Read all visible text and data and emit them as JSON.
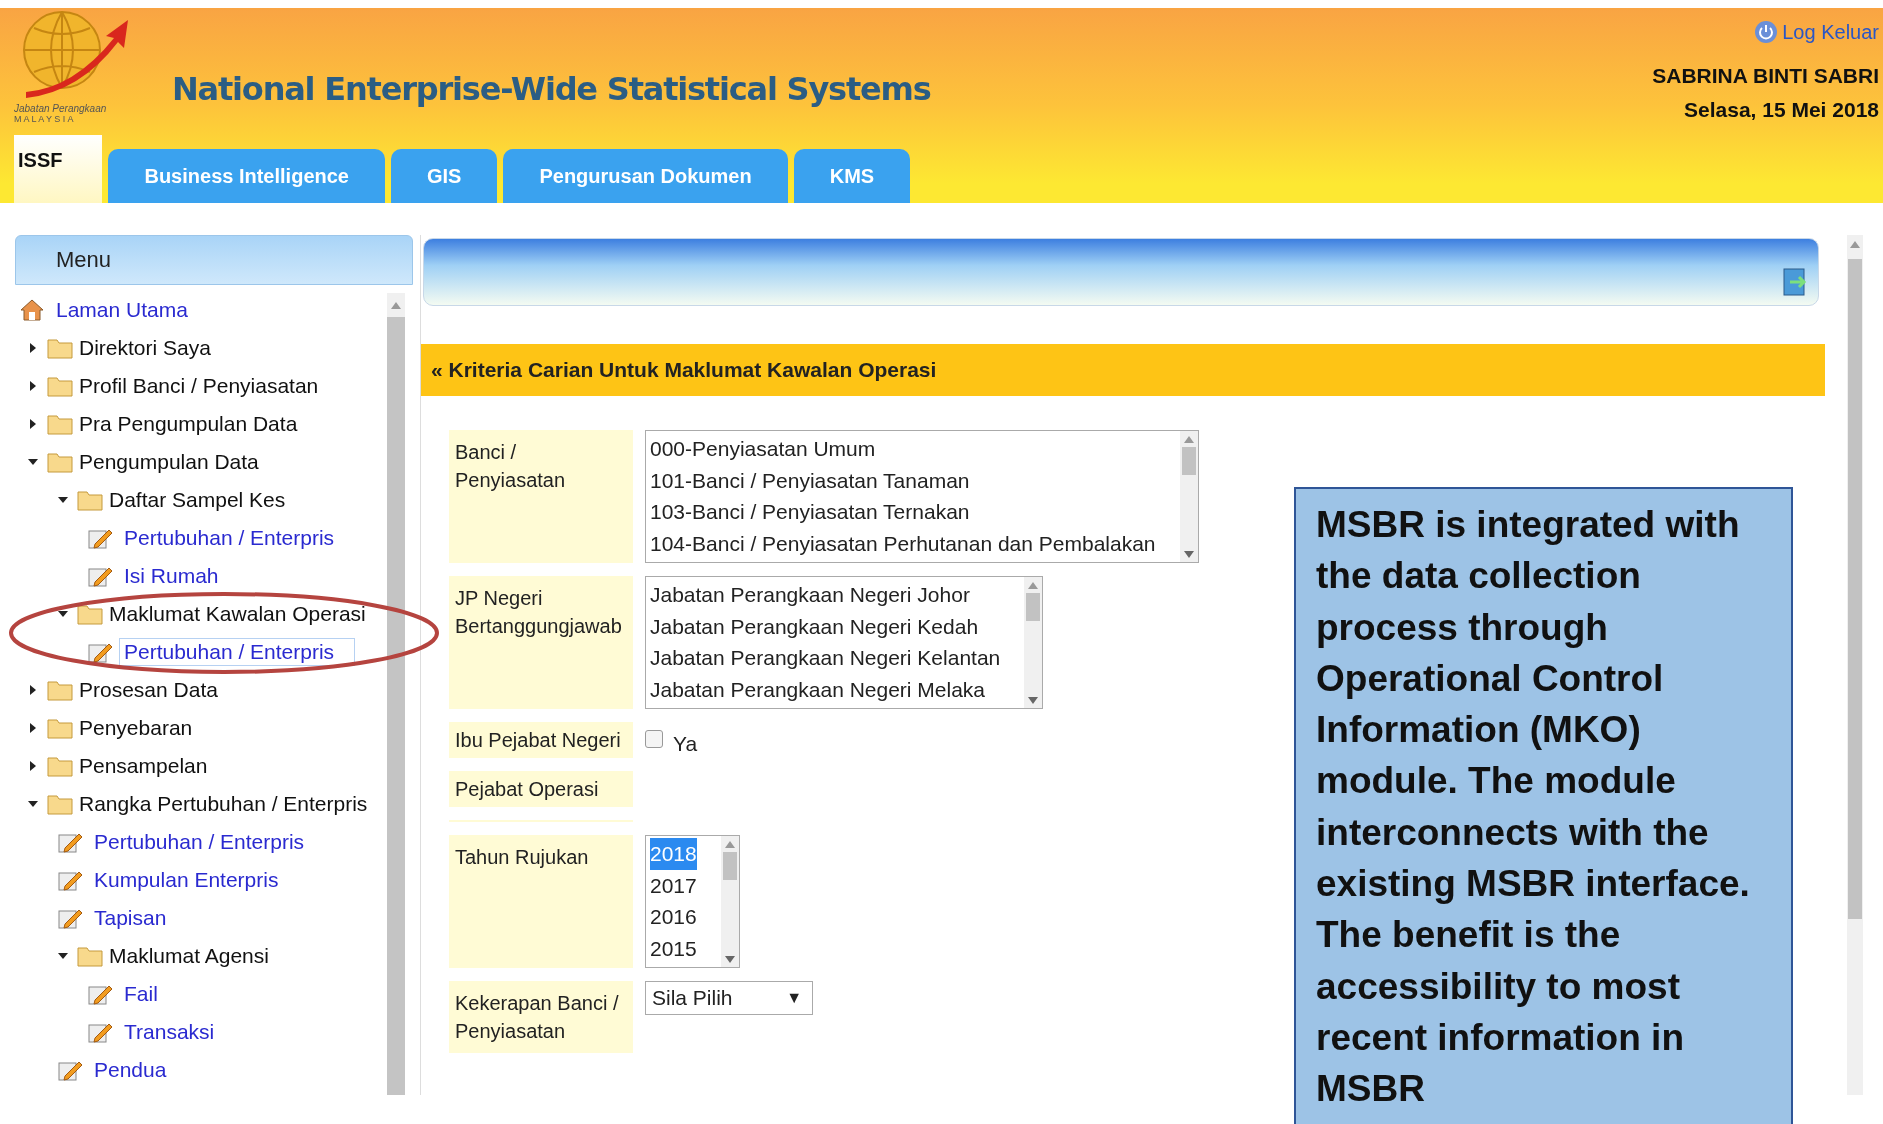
{
  "header": {
    "logo_text": "Jabatan Perangkaan",
    "logo_subtext": "M A L A Y S I A",
    "title": "National Enterprise-Wide Statistical Systems",
    "logout": "Log Keluar",
    "user": "SABRINA BINTI SABRI",
    "date": "Selasa, 15 Mei 2018"
  },
  "tabs": [
    {
      "label": "ISSF",
      "selected": true
    },
    {
      "label": "Business Intelligence",
      "selected": false
    },
    {
      "label": "GIS",
      "selected": false
    },
    {
      "label": "Pengurusan Dokumen",
      "selected": false
    },
    {
      "label": "KMS",
      "selected": false
    }
  ],
  "sidebar": {
    "title": "Menu",
    "items": [
      {
        "kind": "home",
        "label": "Laman Utama",
        "selected": false
      },
      {
        "kind": "folder",
        "label": "Direktori Saya",
        "expanded": false
      },
      {
        "kind": "folder",
        "label": "Profil Banci / Penyiasatan",
        "expanded": false
      },
      {
        "kind": "folder",
        "label": "Pra Pengumpulan Data",
        "expanded": false
      },
      {
        "kind": "folder",
        "label": "Pengumpulan Data",
        "expanded": true,
        "children": [
          {
            "kind": "folder",
            "label": "Daftar Sampel Kes",
            "expanded": true,
            "children": [
              {
                "kind": "page",
                "label": "Pertubuhan / Enterpris",
                "selected": false
              },
              {
                "kind": "page",
                "label": "Isi Rumah",
                "selected": false
              }
            ]
          },
          {
            "kind": "folder",
            "label": "Maklumat Kawalan Operasi",
            "expanded": true,
            "children": [
              {
                "kind": "page",
                "label": "Pertubuhan / Enterpris",
                "selected": true
              }
            ]
          }
        ]
      },
      {
        "kind": "folder",
        "label": "Prosesan Data",
        "expanded": false
      },
      {
        "kind": "folder",
        "label": "Penyebaran",
        "expanded": false
      },
      {
        "kind": "folder",
        "label": "Pensampelan",
        "expanded": false
      },
      {
        "kind": "folder",
        "label": "Rangka Pertubuhan / Enterpris",
        "expanded": true,
        "children": [
          {
            "kind": "page",
            "label": "Pertubuhan / Enterpris",
            "selected": false
          },
          {
            "kind": "page",
            "label": "Kumpulan Enterpris",
            "selected": false
          },
          {
            "kind": "page",
            "label": "Tapisan",
            "selected": false
          },
          {
            "kind": "folder",
            "label": "Maklumat Agensi",
            "expanded": true,
            "children": [
              {
                "kind": "page",
                "label": "Fail",
                "selected": false
              },
              {
                "kind": "page",
                "label": "Transaksi",
                "selected": false
              }
            ]
          },
          {
            "kind": "page",
            "label": "Pendua",
            "selected": false
          }
        ]
      }
    ]
  },
  "panel": {
    "title": "« Kriteria Carian Untuk Maklumat Kawalan Operasi",
    "fields": [
      {
        "kind": "listbox",
        "label": "Banci / Penyiasatan",
        "options": [
          {
            "label": "000-Penyiasatan Umum",
            "selected": false
          },
          {
            "label": "101-Banci / Penyiasatan Tanaman",
            "selected": false
          },
          {
            "label": "103-Banci / Penyiasatan Ternakan",
            "selected": false
          },
          {
            "label": "104-Banci / Penyiasatan Perhutanan dan Pembalakan",
            "selected": false
          }
        ]
      },
      {
        "kind": "listbox",
        "label": "JP Negeri Bertanggungjawab",
        "options": [
          {
            "label": "Jabatan Perangkaan Negeri Johor",
            "selected": false
          },
          {
            "label": "Jabatan Perangkaan Negeri Kedah",
            "selected": false
          },
          {
            "label": "Jabatan Perangkaan Negeri Kelantan",
            "selected": false
          },
          {
            "label": "Jabatan Perangkaan Negeri Melaka",
            "selected": false
          }
        ]
      },
      {
        "kind": "checkbox",
        "label": "Ibu Pejabat Negeri",
        "option": "Ya",
        "checked": false
      },
      {
        "kind": "empty",
        "label": "Pejabat Operasi"
      },
      {
        "kind": "blank"
      },
      {
        "kind": "listbox",
        "label": "Tahun Rujukan",
        "options": [
          {
            "label": "2018",
            "selected": true
          },
          {
            "label": "2017",
            "selected": false
          },
          {
            "label": "2016",
            "selected": false
          },
          {
            "label": "2015",
            "selected": false
          }
        ]
      },
      {
        "kind": "select",
        "label": "Kekerapan Banci / Penyiasatan",
        "value": "Sila Pilih",
        "arrow": "▼"
      }
    ]
  },
  "callout": {
    "text": "MSBR is integrated with the data collection process  through Operational Control Information (MKO) module. The module interconnects with the existing MSBR interface. The benefit is the accessibility to most recent information in MSBR"
  }
}
